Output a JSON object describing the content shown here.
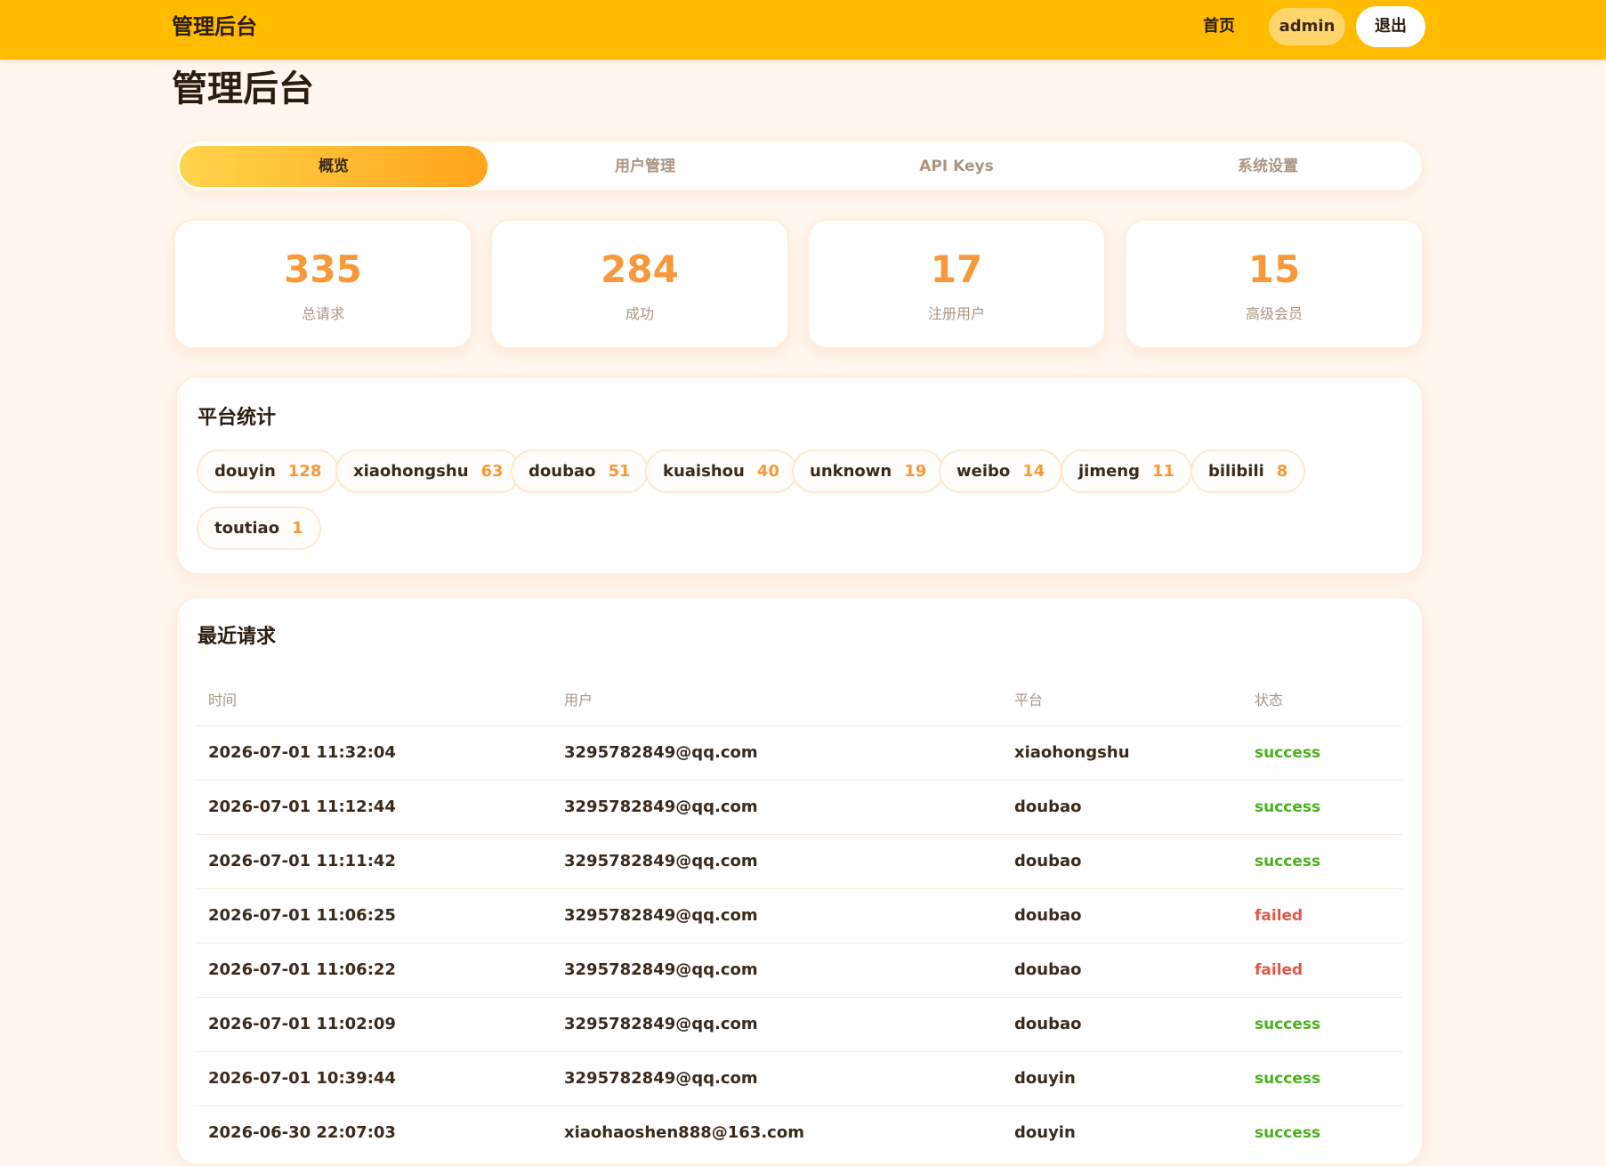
{
  "header": {
    "brand": "管理后台",
    "nav_home": "首页",
    "user": "admin",
    "logout": "退出",
    "accent_color": "#ffbb00"
  },
  "page": {
    "title": "管理后台"
  },
  "tabs": [
    {
      "label": "概览",
      "active": true
    },
    {
      "label": "用户管理",
      "active": false
    },
    {
      "label": "API Keys",
      "active": false
    },
    {
      "label": "系统设置",
      "active": false
    }
  ],
  "stats": [
    {
      "value": "335",
      "label": "总请求"
    },
    {
      "value": "284",
      "label": "成功"
    },
    {
      "value": "17",
      "label": "注册用户"
    },
    {
      "value": "15",
      "label": "高级会员"
    }
  ],
  "platform_stats": {
    "title": "平台统计",
    "items": [
      {
        "name": "douyin",
        "count": "128"
      },
      {
        "name": "xiaohongshu",
        "count": "63"
      },
      {
        "name": "doubao",
        "count": "51"
      },
      {
        "name": "kuaishou",
        "count": "40"
      },
      {
        "name": "unknown",
        "count": "19"
      },
      {
        "name": "weibo",
        "count": "14"
      },
      {
        "name": "jimeng",
        "count": "11"
      },
      {
        "name": "bilibili",
        "count": "8"
      },
      {
        "name": "toutiao",
        "count": "1"
      }
    ]
  },
  "recent_requests": {
    "title": "最近请求",
    "columns": [
      "时间",
      "用户",
      "平台",
      "状态"
    ],
    "rows": [
      {
        "time": "2026-07-01 11:32:04",
        "user": "3295782849@qq.com",
        "platform": "xiaohongshu",
        "status": "success"
      },
      {
        "time": "2026-07-01 11:12:44",
        "user": "3295782849@qq.com",
        "platform": "doubao",
        "status": "success"
      },
      {
        "time": "2026-07-01 11:11:42",
        "user": "3295782849@qq.com",
        "platform": "doubao",
        "status": "success"
      },
      {
        "time": "2026-07-01 11:06:25",
        "user": "3295782849@qq.com",
        "platform": "doubao",
        "status": "failed"
      },
      {
        "time": "2026-07-01 11:06:22",
        "user": "3295782849@qq.com",
        "platform": "doubao",
        "status": "failed"
      },
      {
        "time": "2026-07-01 11:02:09",
        "user": "3295782849@qq.com",
        "platform": "doubao",
        "status": "success"
      },
      {
        "time": "2026-07-01 10:39:44",
        "user": "3295782849@qq.com",
        "platform": "douyin",
        "status": "success"
      },
      {
        "time": "2026-06-30 22:07:03",
        "user": "xiaohaoshen888@163.com",
        "platform": "douyin",
        "status": "success"
      }
    ]
  },
  "colors": {
    "success": "#4caf1f",
    "failed": "#e0574a",
    "stat_value": "#f7993a"
  }
}
